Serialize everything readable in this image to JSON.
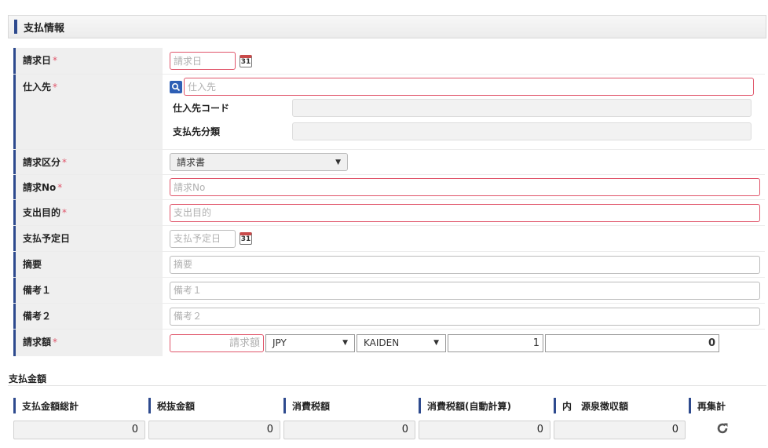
{
  "section": {
    "title": "支払情報"
  },
  "required_mark": "*",
  "calendar_day": "31",
  "fields": {
    "invoice_date": {
      "label": "請求日",
      "placeholder": "請求日"
    },
    "supplier": {
      "label": "仕入先",
      "placeholder": "仕入先",
      "code_label": "仕入先コード",
      "category_label": "支払先分類"
    },
    "invoice_type": {
      "label": "請求区分",
      "value": "請求書"
    },
    "invoice_no": {
      "label": "請求No",
      "placeholder": "請求No"
    },
    "purpose": {
      "label": "支出目的",
      "placeholder": "支出目的"
    },
    "payment_due": {
      "label": "支払予定日",
      "placeholder": "支払予定日"
    },
    "summary": {
      "label": "摘要",
      "placeholder": "摘要"
    },
    "remark1": {
      "label": "備考１",
      "placeholder": "備考１"
    },
    "remark2": {
      "label": "備考２",
      "placeholder": "備考２"
    },
    "invoice_amount": {
      "label": "請求額",
      "placeholder": "請求額",
      "currency": "JPY",
      "rate_type": "KAIDEN",
      "rate": "1",
      "converted": "0"
    }
  },
  "payment": {
    "title": "支払金額",
    "columns": [
      "支払金額総計",
      "税抜金額",
      "消費税額",
      "消費税額(自動計算)",
      "内　源泉徴収額",
      "再集計"
    ],
    "values": [
      "0",
      "0",
      "0",
      "0",
      "0"
    ]
  },
  "icons": {
    "calendar": "calendar-icon",
    "search": "search-icon",
    "refresh": "refresh-icon",
    "caret": "chevron-down-icon"
  },
  "colors": {
    "accent": "#2e4a8e",
    "required": "#e0556a"
  }
}
